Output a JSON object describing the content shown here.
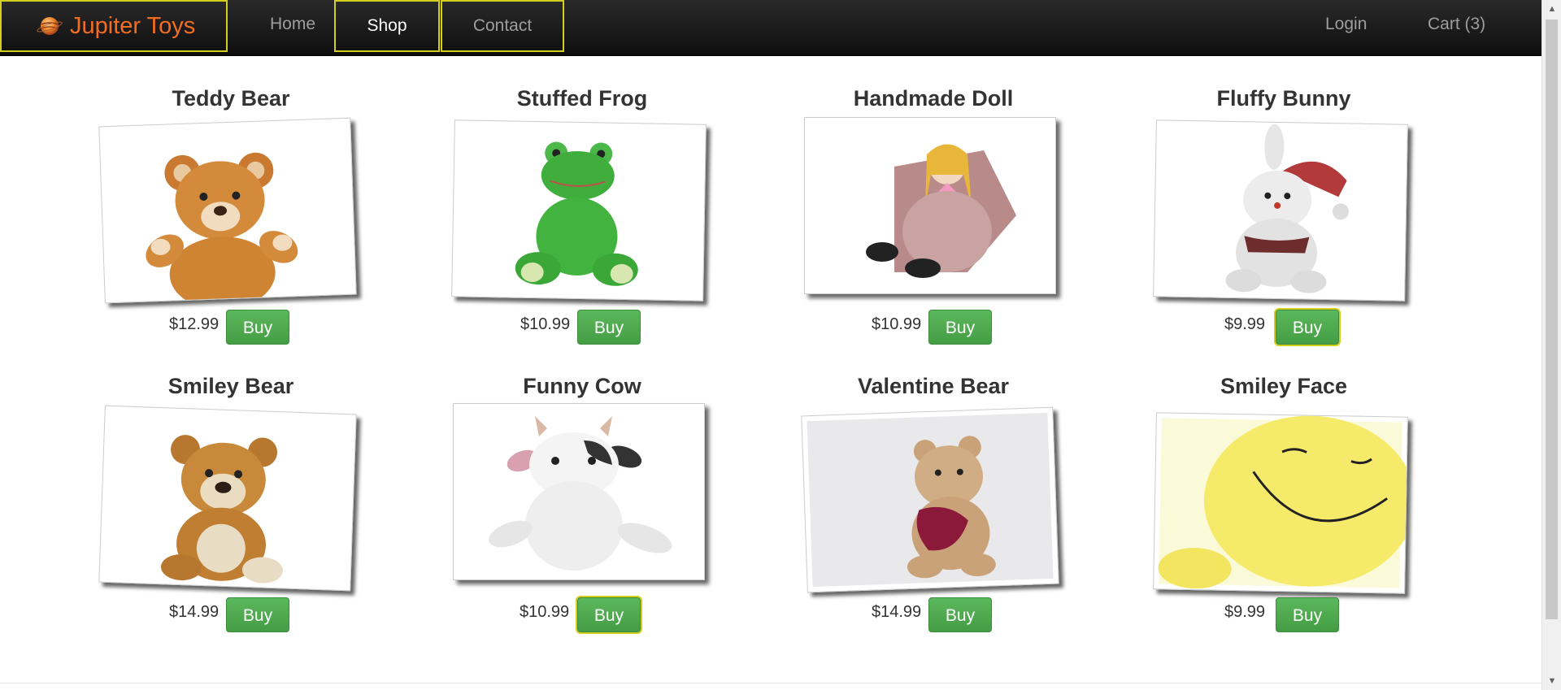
{
  "brand": {
    "name": "Jupiter Toys",
    "logo_icon": "planet-icon",
    "color": "#f26d21"
  },
  "nav": {
    "home": "Home",
    "shop": "Shop",
    "contact": "Contact",
    "login": "Login",
    "cart": "Cart (3)"
  },
  "colors": {
    "buy_button": "#5cb85c",
    "focus_outline": "#d4cf1c",
    "navbar": "#1a1a1a"
  },
  "buy_label": "Buy",
  "products": [
    {
      "title": "Teddy Bear",
      "price": "$12.99",
      "image": "teddy-bear-image"
    },
    {
      "title": "Stuffed Frog",
      "price": "$10.99",
      "image": "stuffed-frog-image"
    },
    {
      "title": "Handmade Doll",
      "price": "$10.99",
      "image": "handmade-doll-image"
    },
    {
      "title": "Fluffy Bunny",
      "price": "$9.99",
      "image": "fluffy-bunny-image"
    },
    {
      "title": "Smiley Bear",
      "price": "$14.99",
      "image": "smiley-bear-image"
    },
    {
      "title": "Funny Cow",
      "price": "$10.99",
      "image": "funny-cow-image"
    },
    {
      "title": "Valentine Bear",
      "price": "$14.99",
      "image": "valentine-bear-image"
    },
    {
      "title": "Smiley Face",
      "price": "$9.99",
      "image": "smiley-face-image"
    }
  ]
}
